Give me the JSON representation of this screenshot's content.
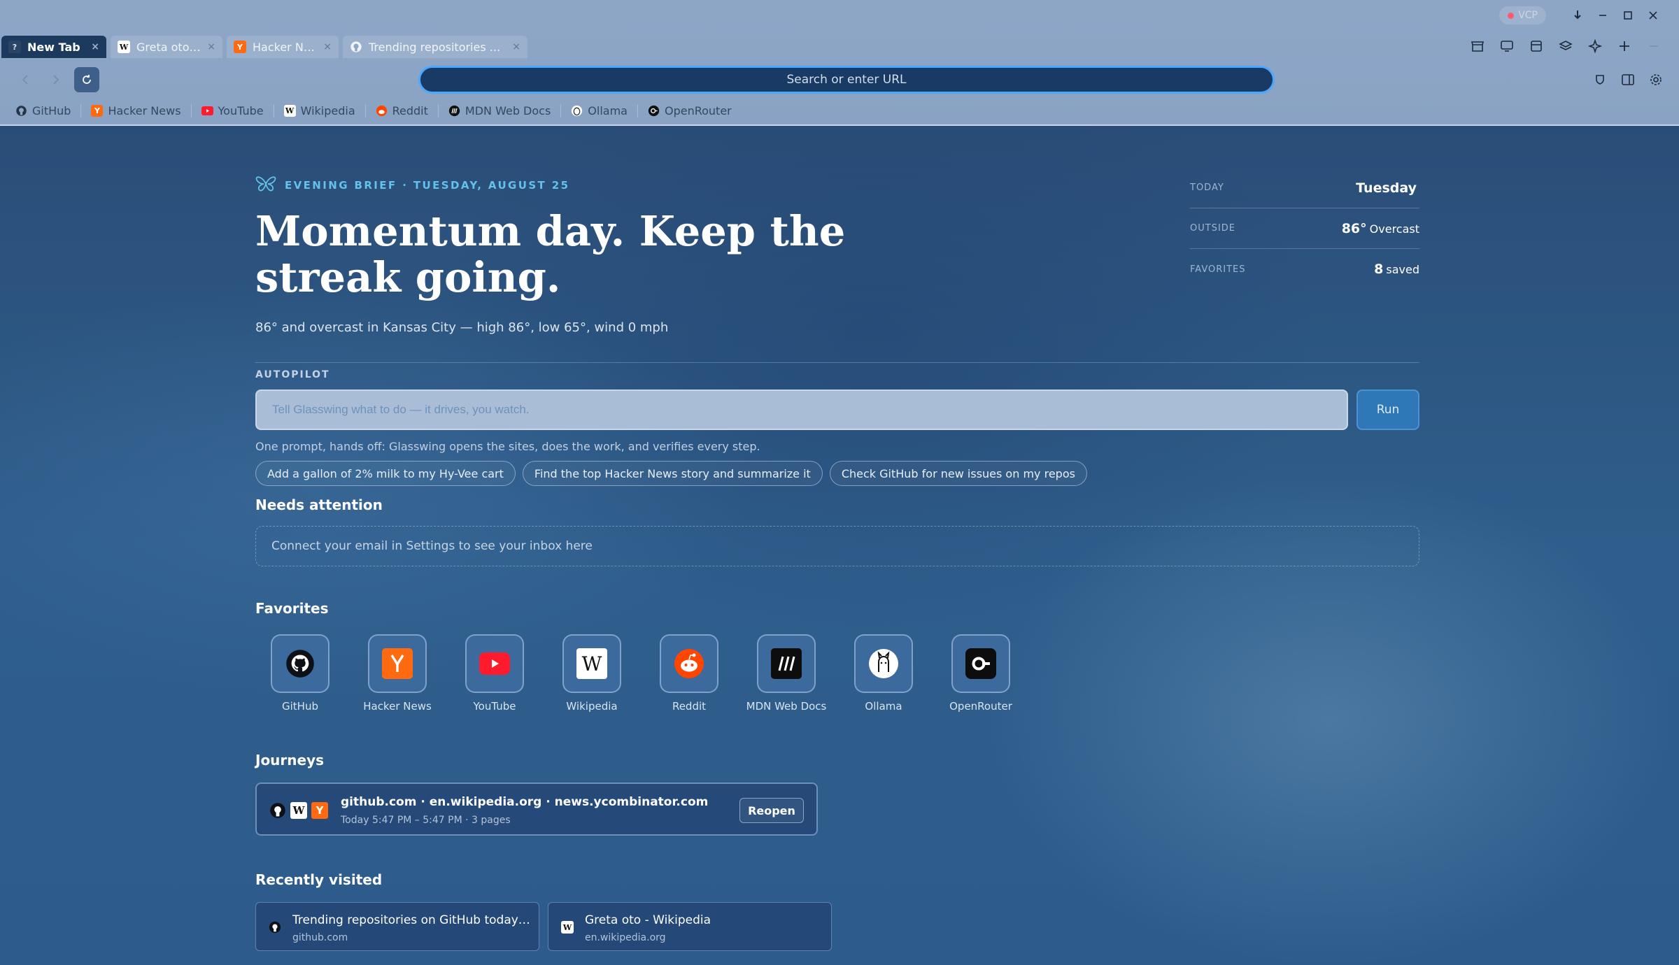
{
  "window": {
    "vpn_label": "VCP",
    "colors": {
      "chrome": "#8ea6c6",
      "accent": "#4aa8ff",
      "active_tab": "#1c3a5e"
    }
  },
  "tabs": [
    {
      "title": "New Tab",
      "favicon": "question-icon",
      "active": true
    },
    {
      "title": "Greta oto - Wikipedia",
      "favicon": "wikipedia-icon",
      "active": false
    },
    {
      "title": "Hacker News",
      "favicon": "hacker-news-icon",
      "active": false
    },
    {
      "title": "Trending repositories ...",
      "favicon": "github-icon",
      "active": false
    }
  ],
  "urlbar": {
    "placeholder": "Search or enter URL"
  },
  "bookmarks": [
    {
      "label": "GitHub",
      "icon": "github-icon"
    },
    {
      "label": "Hacker News",
      "icon": "hacker-news-icon"
    },
    {
      "label": "YouTube",
      "icon": "youtube-icon"
    },
    {
      "label": "Wikipedia",
      "icon": "wikipedia-icon"
    },
    {
      "label": "Reddit",
      "icon": "reddit-icon"
    },
    {
      "label": "MDN Web Docs",
      "icon": "mdn-icon"
    },
    {
      "label": "Ollama",
      "icon": "ollama-icon"
    },
    {
      "label": "OpenRouter",
      "icon": "openrouter-icon"
    }
  ],
  "brief": {
    "label": "EVENING BRIEF · TUESDAY, AUGUST 25",
    "headline": "Momentum day. Keep the streak going.",
    "subline": "86° and overcast in Kansas City — high 86°, low 65°, wind 0 mph"
  },
  "stats": [
    {
      "key": "TODAY",
      "value_bold": "Tuesday",
      "value_rest": ""
    },
    {
      "key": "OUTSIDE",
      "value_bold": "86°",
      "value_rest": "Overcast"
    },
    {
      "key": "FAVORITES",
      "value_bold": "8",
      "value_rest": "saved"
    }
  ],
  "autopilot": {
    "label": "AUTOPILOT",
    "placeholder": "Tell Glasswing what to do — it drives, you watch.",
    "run_label": "Run",
    "hint": "One prompt, hands off: Glasswing opens the sites, does the work, and verifies every step.",
    "suggestions": [
      "Add a gallon of 2% milk to my Hy-Vee cart",
      "Find the top Hacker News story and summarize it",
      "Check GitHub for new issues on my repos"
    ]
  },
  "attention": {
    "title": "Needs attention",
    "message": "Connect your email in Settings to see your inbox here"
  },
  "favorites": {
    "title": "Favorites",
    "items": [
      {
        "label": "GitHub",
        "icon": "github-icon"
      },
      {
        "label": "Hacker News",
        "icon": "hacker-news-icon"
      },
      {
        "label": "YouTube",
        "icon": "youtube-icon"
      },
      {
        "label": "Wikipedia",
        "icon": "wikipedia-icon"
      },
      {
        "label": "Reddit",
        "icon": "reddit-icon"
      },
      {
        "label": "MDN Web Docs",
        "icon": "mdn-icon"
      },
      {
        "label": "Ollama",
        "icon": "ollama-icon"
      },
      {
        "label": "OpenRouter",
        "icon": "openrouter-icon"
      }
    ]
  },
  "journeys": {
    "title": "Journeys",
    "items": [
      {
        "sites": "github.com · en.wikipedia.org · news.ycombinator.com",
        "meta": "Today 5:47 PM – 5:47 PM · 3 pages",
        "action": "Reopen"
      }
    ]
  },
  "recent": {
    "title": "Recently visited",
    "items": [
      {
        "title": "Trending repositories on GitHub today · ...",
        "host": "github.com",
        "icon": "github-icon"
      },
      {
        "title": "Greta oto - Wikipedia",
        "host": "en.wikipedia.org",
        "icon": "wikipedia-icon"
      }
    ]
  }
}
